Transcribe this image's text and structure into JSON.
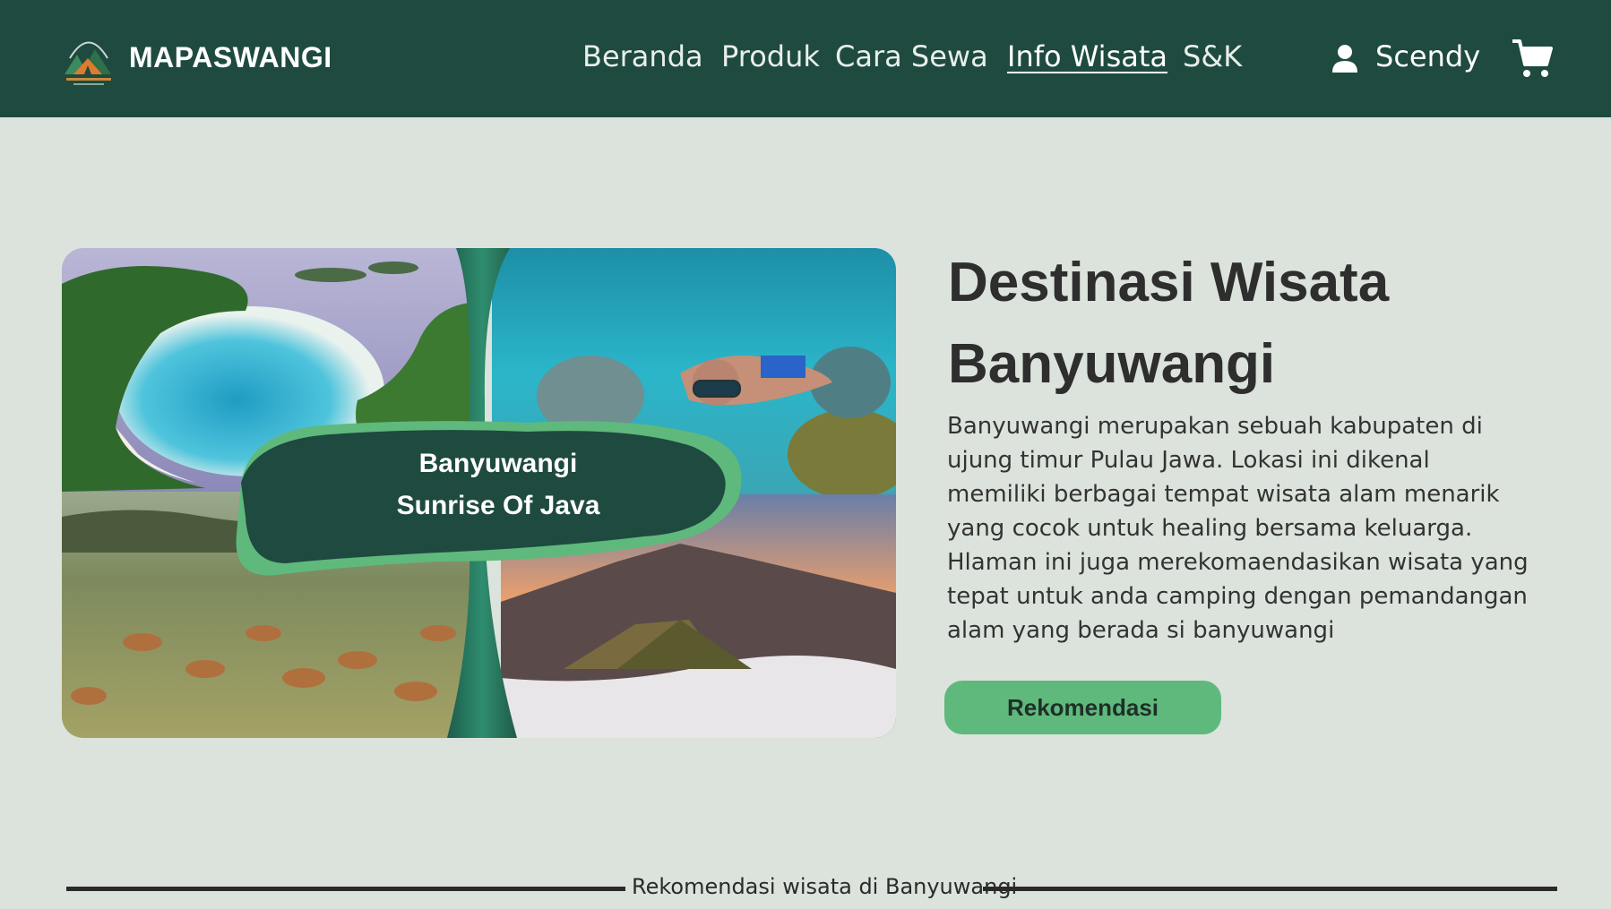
{
  "header": {
    "brand": "MAPASWANGI",
    "logo_icon": "camping-tent-mountain-logo",
    "nav": [
      {
        "label": "Beranda",
        "active": false
      },
      {
        "label": "Produk",
        "active": false
      },
      {
        "label": "Cara Sewa",
        "active": false
      },
      {
        "label": "Info Wisata",
        "active": true
      },
      {
        "label": "S&K",
        "active": false
      }
    ],
    "user_icon": "person-icon",
    "user_name": "Scendy",
    "cart_icon": "shopping-cart-icon"
  },
  "hero": {
    "collage_badge_line1": "Banyuwangi",
    "collage_badge_line2": "Sunrise Of Java",
    "title_line1": "Destinasi Wisata",
    "title_line2": "Banyuwangi",
    "paragraph1": "Banyuwangi merupakan sebuah kabupaten di ujung timur Pulau Jawa. Lokasi ini dikenal memiliki berbagai tempat wisata alam menarik yang cocok untuk healing bersama keluarga.",
    "paragraph2": "Hlaman ini juga merekomaendasikan wisata yang tepat untuk anda camping dengan pemandangan alam yang berada si banyuwangi",
    "button_label": "Rekomendasi"
  },
  "section": {
    "divider_label": "Rekomendasi wisata di Banyuwangi"
  },
  "colors": {
    "navbar": "#1e4a40",
    "background": "#dce3dc",
    "accent_green": "#5fb97c",
    "badge_dark": "#1f4a3f"
  }
}
